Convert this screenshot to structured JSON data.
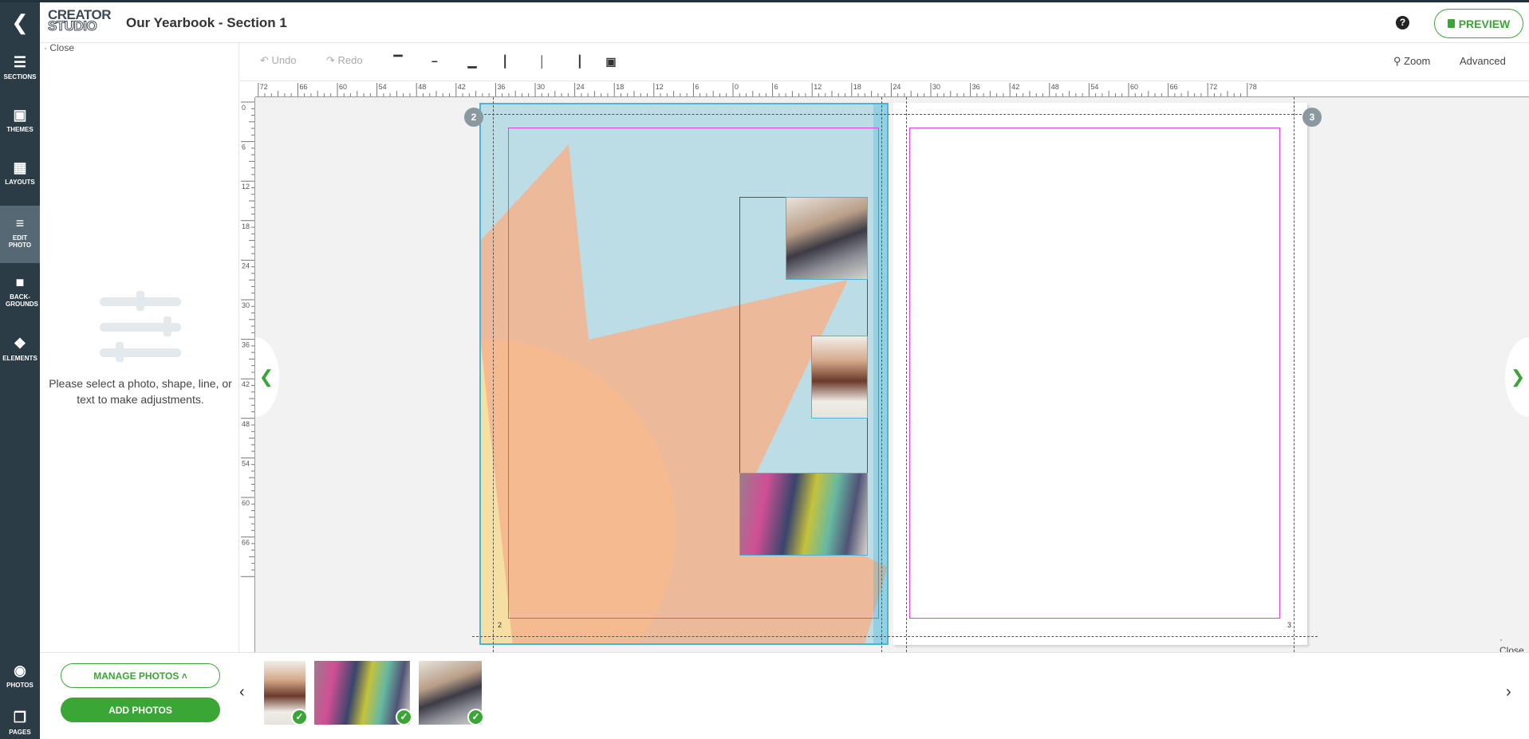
{
  "header": {
    "logo_line1": "CREATOR",
    "logo_line2": "STUDIO",
    "title": "Our Yearbook - Section 1",
    "help": "?",
    "preview_label": "PREVIEW"
  },
  "nav": {
    "items": [
      {
        "label": "SECTIONS",
        "icon": "hamburger-icon"
      },
      {
        "label": "THEMES",
        "icon": "frame-icon"
      },
      {
        "label": "LAYOUTS",
        "icon": "grid-icon"
      },
      {
        "label": "EDIT PHOTO",
        "icon": "sliders-icon",
        "active": true
      },
      {
        "label": "BACK-GROUNDS",
        "icon": "background-icon"
      },
      {
        "label": "ELEMENTS",
        "icon": "shapes-icon"
      },
      {
        "label": "PHOTOS",
        "icon": "camera-icon"
      },
      {
        "label": "PAGES",
        "icon": "pages-icon"
      }
    ]
  },
  "panel": {
    "close_label": "Close",
    "message": "Please select a photo, shape, line, or text to make adjustments."
  },
  "toolbar": {
    "undo_label": "Undo",
    "redo_label": "Redo",
    "zoom_label": "Zoom",
    "advanced_label": "Advanced",
    "align_icons": [
      "align-top-icon",
      "align-middle-icon",
      "align-bottom-icon",
      "align-left-icon",
      "align-center-icon",
      "align-right-icon",
      "crop-icon"
    ]
  },
  "rulers": {
    "horizontal": [
      "78",
      "72",
      "66",
      "60",
      "54",
      "48",
      "42",
      "36",
      "30",
      "24",
      "18",
      "12",
      "6",
      "0",
      "6",
      "12",
      "18",
      "24",
      "30",
      "36",
      "42",
      "48",
      "54",
      "60",
      "66",
      "72",
      "78"
    ],
    "vertical": [
      "0",
      "6",
      "12",
      "18",
      "24",
      "30",
      "36",
      "42",
      "48",
      "54",
      "60",
      "66"
    ]
  },
  "spread": {
    "left_page_badge": "2",
    "right_page_badge": "3",
    "left_page_number": "2",
    "right_page_number": "3"
  },
  "canvas": {
    "close_label": "Close"
  },
  "bottom": {
    "manage_label": "MANAGE PHOTOS",
    "add_label": "ADD PHOTOS",
    "thumbnails": [
      "photo-boy-eating-cake",
      "photo-group-running",
      "photo-teens-skateboard"
    ]
  },
  "colors": {
    "nav_bg": "#2c3c46",
    "accent_green": "#3aa635",
    "selection_blue": "#49b6d8",
    "safe_zone_magenta": "#e042e6"
  }
}
